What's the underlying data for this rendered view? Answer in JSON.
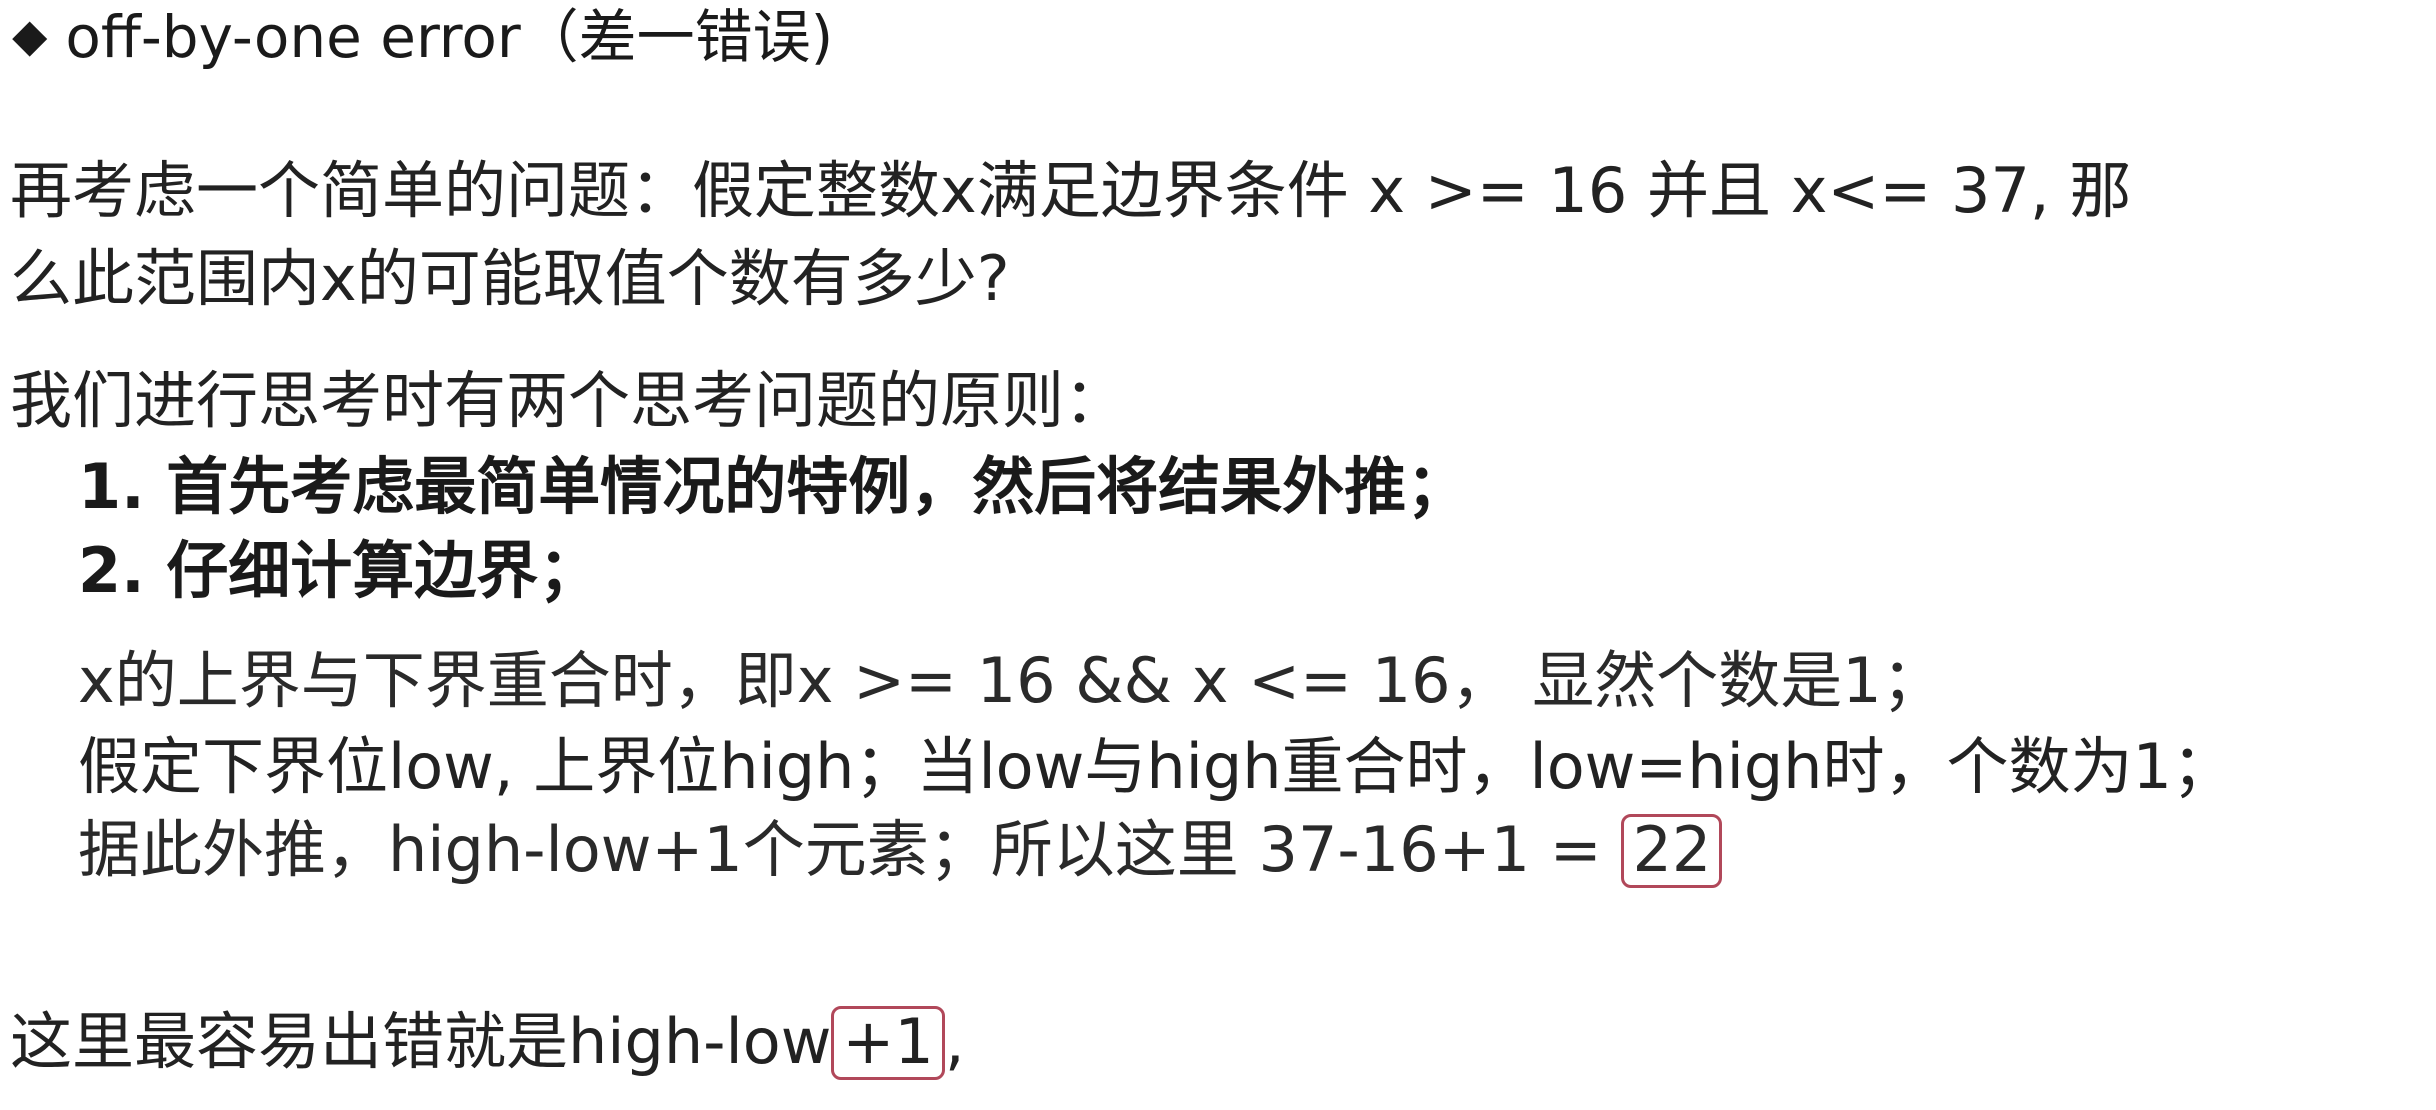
{
  "title": {
    "bullet": "◆",
    "text": "off-by-one error（差一错误)"
  },
  "question": {
    "line1": "再考虑一个简单的问题：假定整数x满足边界条件 x >= 16 并且 x<= 37, 那",
    "line2": "么此范围内x的可能取值个数有多少?"
  },
  "principles": {
    "intro": "我们进行思考时有两个思考问题的原则：",
    "items": [
      "1. 首先考虑最简单情况的特例，然后将结果外推；",
      "2. 仔细计算边界；"
    ]
  },
  "explanation": {
    "line1": "x的上界与下界重合时，即x >= 16 && x <= 16，  显然个数是1；",
    "line2": "假定下界位low, 上界位high；当low与high重合时，low=high时，个数为1；",
    "line3_prefix": "据此外推，high-low+1个元素；所以这里 37-16+1 =",
    "line3_answer": "22"
  },
  "conclusion": {
    "prefix": "这里最容易出错就是high-low",
    "highlight": "+1",
    "suffix": ","
  },
  "colors": {
    "box_border": "#b1485a"
  }
}
